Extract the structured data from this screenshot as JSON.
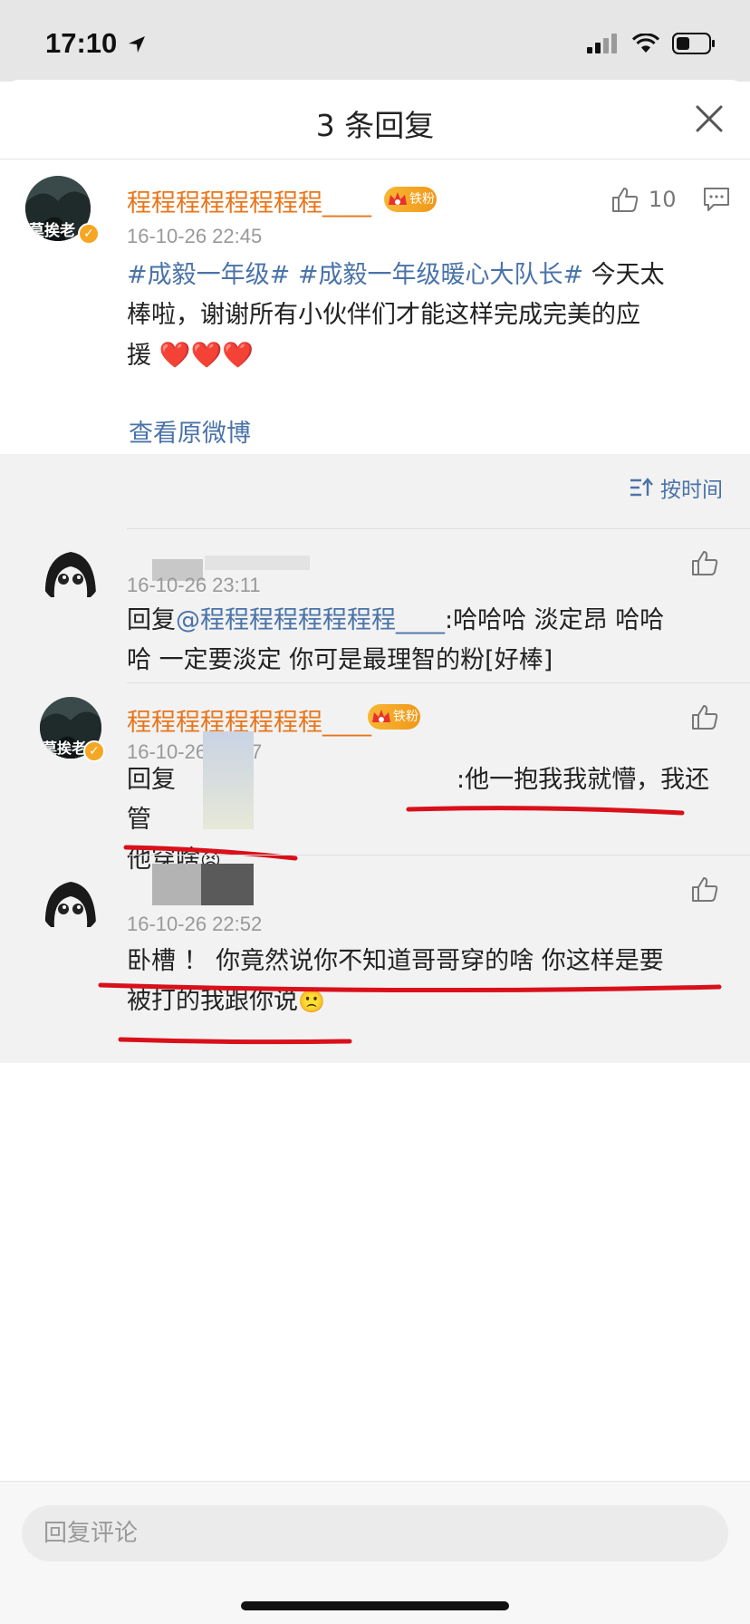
{
  "status_bar": {
    "time": "17:10"
  },
  "header": {
    "title": "3 条回复"
  },
  "main_post": {
    "username": "程程程程程程程程____",
    "badge": "铁粉",
    "time": "16-10-26 22:45",
    "topic1": "#成毅一年级#",
    "topic2": "#成毅一年级暖心大队长#",
    "text_a": " 今天太",
    "text_b": "棒啦，谢谢所有小伙伴们才能这样完成完美的应",
    "text_c": "援",
    "hearts": "❤️❤️❤️",
    "like_count": "10",
    "view_original": "查看原微博"
  },
  "sort": {
    "label": "按时间"
  },
  "replies": [
    {
      "username": "",
      "time": "16-10-26 23:11",
      "prefix": "回复",
      "mention": "@程程程程程程程程____",
      "line1": ":哈哈哈  淡定昂  哈哈",
      "line2": "哈  一定要淡定  你可是最理智的粉[好棒]"
    },
    {
      "username": "程程程程程程程程____",
      "badge": "铁粉",
      "time": "16-10-26 23:07",
      "prefix": "回复",
      "line1": ":他一抱我我就懵，我还管",
      "line2": "他穿啥",
      "emoji": "😣"
    },
    {
      "username": "",
      "time": "16-10-26 22:52",
      "line1": "卧槽 ！ 你竟然说你不知道哥哥穿的啥  你这样是要",
      "line2": "被打的我跟你说",
      "emoji": "🙁"
    }
  ],
  "input": {
    "placeholder": "回复评论"
  },
  "colors": {
    "username": "#e8751a",
    "link": "#4a73a8",
    "annotation": "#d9101a"
  }
}
